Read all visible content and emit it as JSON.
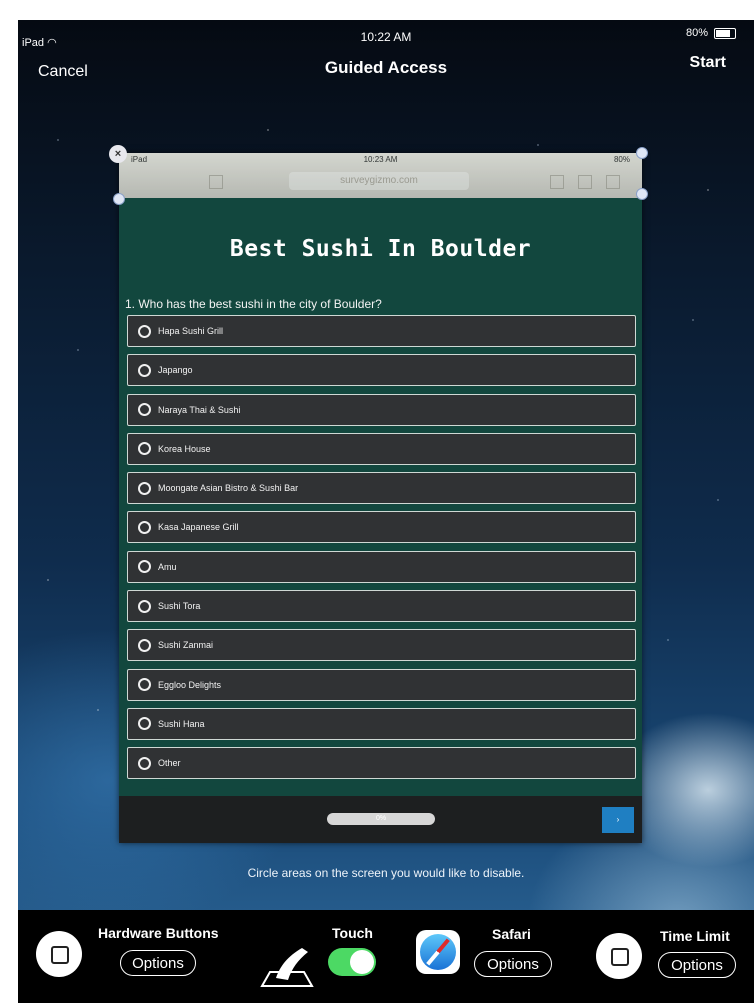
{
  "status_bar": {
    "device": "iPad",
    "time": "10:22 AM",
    "battery": "80%"
  },
  "nav": {
    "cancel": "Cancel",
    "title": "Guided Access",
    "start": "Start"
  },
  "mini_browser": {
    "status_time": "10:23 AM",
    "status_device": "iPad",
    "status_battery": "80%",
    "url": "surveygizmo.com"
  },
  "survey": {
    "title": "Best Sushi In Boulder",
    "question": "1. Who has the best sushi in the city of Boulder?",
    "options": [
      "Hapa Sushi Grill",
      "Japango",
      "Naraya Thai & Sushi",
      "Korea House",
      "Moongate Asian Bistro & Sushi Bar",
      "Kasa Japanese Grill",
      "Amu",
      "Sushi Tora",
      "Sushi Zanmai",
      "Eggloo Delights",
      "Sushi Hana",
      "Other"
    ],
    "progress": "0%",
    "next": "›"
  },
  "hint": "Circle areas on the screen you would like to disable.",
  "bottom": {
    "hardware_label": "Hardware Buttons",
    "hardware_options": "Options",
    "touch_label": "Touch",
    "touch_enabled": true,
    "safari_label": "Safari",
    "safari_options": "Options",
    "time_limit_label": "Time Limit",
    "time_limit_options": "Options"
  },
  "colors": {
    "toggle_on": "#4cd964",
    "survey_bg": "#12473e",
    "next_button": "#1f7fc2"
  }
}
